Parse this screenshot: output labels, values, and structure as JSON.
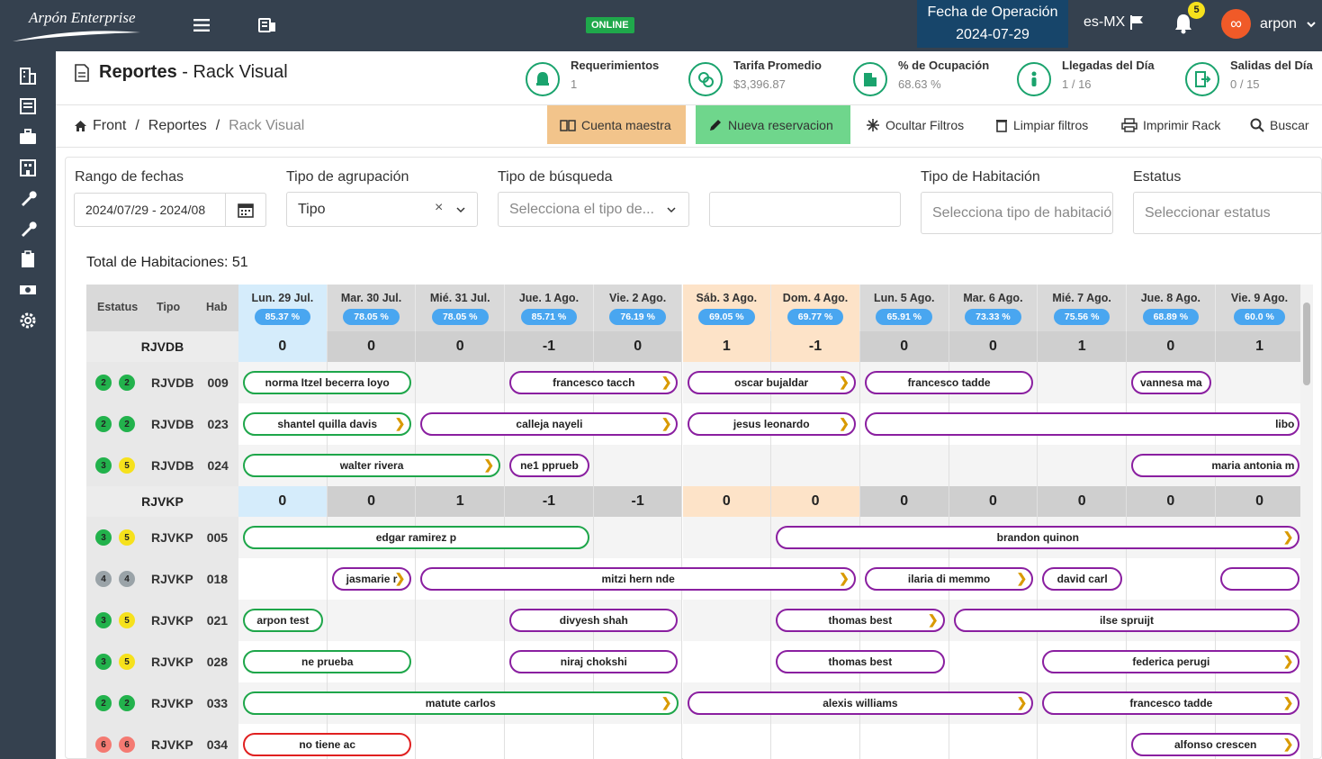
{
  "app": {
    "logo_text": "Arpón Enterprise",
    "online_label": "ONLINE"
  },
  "opdate": {
    "label": "Fecha de Operación",
    "value": "2024-07-29"
  },
  "lang": "es-MX",
  "notifications": {
    "count": "5"
  },
  "user": {
    "name": "arpon"
  },
  "page": {
    "section": "Reportes",
    "title": " - Rack Visual"
  },
  "stats": [
    {
      "label": "Requerimientos",
      "value": "1"
    },
    {
      "label": "Tarifa Promedio",
      "value": "$3,396.87"
    },
    {
      "label": "% de Ocupación",
      "value": "68.63 %"
    },
    {
      "label": "Llegadas del Día",
      "value": "1 / 16"
    },
    {
      "label": "Salidas del Día",
      "value": "0 / 15"
    }
  ],
  "breadcrumb": {
    "home": "Front",
    "sep": "/",
    "reportes": "Reportes",
    "current": "Rack Visual"
  },
  "toolbar": {
    "cuenta": "Cuenta maestra",
    "nueva": "Nueva reservacion",
    "ocultar": "Ocultar Filtros",
    "limpiar": "Limpiar filtros",
    "imprimir": "Imprimir Rack",
    "buscar": "Buscar"
  },
  "filters": {
    "rango_label": "Rango de fechas",
    "rango_value": "2024/07/29 - 2024/08",
    "agrupacion_label": "Tipo de agrupación",
    "agrupacion_value": "Tipo",
    "busqueda_label": "Tipo de búsqueda",
    "busqueda_placeholder": "Selecciona el tipo de...",
    "habitacion_label": "Tipo de Habitación",
    "habitacion_placeholder": "Selecciona tipo de habitació",
    "estatus_label": "Estatus",
    "estatus_placeholder": "Seleccionar estatus"
  },
  "total": "Total de Habitaciones: 51",
  "grid_headers": {
    "estatus": "Estatus",
    "tipo": "Tipo",
    "hab": "Hab"
  },
  "colors": {
    "topbar": "#35414f",
    "accent_green": "#1aa36d",
    "weekend": "#fde3c8",
    "today": "#d5ecfb",
    "res_green": "#1ea64a",
    "res_purple": "#8a1fa0",
    "res_red": "#e02020"
  },
  "days": [
    {
      "label": "Lun. 29 Jul.",
      "pct": "85.37 %",
      "kind": "today"
    },
    {
      "label": "Mar. 30 Jul.",
      "pct": "78.05 %",
      "kind": "normal"
    },
    {
      "label": "Mié. 31 Jul.",
      "pct": "78.05 %",
      "kind": "normal"
    },
    {
      "label": "Jue. 1 Ago.",
      "pct": "85.71 %",
      "kind": "normal"
    },
    {
      "label": "Vie. 2 Ago.",
      "pct": "76.19 %",
      "kind": "normal"
    },
    {
      "label": "Sáb. 3 Ago.",
      "pct": "69.05 %",
      "kind": "weekend"
    },
    {
      "label": "Dom. 4 Ago.",
      "pct": "69.77 %",
      "kind": "weekend"
    },
    {
      "label": "Lun. 5 Ago.",
      "pct": "65.91 %",
      "kind": "normal"
    },
    {
      "label": "Mar. 6 Ago.",
      "pct": "73.33 %",
      "kind": "normal"
    },
    {
      "label": "Mié. 7 Ago.",
      "pct": "75.56 %",
      "kind": "normal"
    },
    {
      "label": "Jue. 8 Ago.",
      "pct": "68.89 %",
      "kind": "normal"
    },
    {
      "label": "Vie. 9 Ago.",
      "pct": "60.0 %",
      "kind": "normal"
    }
  ],
  "groups": [
    {
      "name": "RJVDB",
      "counts": [
        "0",
        "0",
        "0",
        "-1",
        "0",
        "1",
        "-1",
        "0",
        "0",
        "1",
        "0",
        "1"
      ],
      "rooms": [
        {
          "s1": "2",
          "s1c": "green",
          "s2": "2",
          "s2c": "green",
          "tipo": "RJVDB",
          "hab": "009",
          "res": [
            {
              "name": "norma Itzel becerra loyo",
              "start": 0,
              "span": 2,
              "color": "g",
              "arrow": false
            },
            {
              "name": "francesco tacch",
              "start": 3,
              "span": 2,
              "color": "p",
              "arrow": true
            },
            {
              "name": "oscar bujaldar",
              "start": 5,
              "span": 2,
              "color": "p",
              "arrow": true
            },
            {
              "name": "francesco tadde",
              "start": 7,
              "span": 2,
              "color": "p",
              "arrow": false
            },
            {
              "name": "vannesa ma",
              "start": 10,
              "span": 1,
              "color": "p",
              "arrow": false
            }
          ]
        },
        {
          "s1": "2",
          "s1c": "green",
          "s2": "2",
          "s2c": "green",
          "tipo": "RJVDB",
          "hab": "023",
          "res": [
            {
              "name": "shantel quilla davis",
              "start": 0,
              "span": 2,
              "color": "g",
              "arrow": true
            },
            {
              "name": "calleja nayeli",
              "start": 2,
              "span": 3,
              "color": "p",
              "arrow": true
            },
            {
              "name": "jesus leonardo",
              "start": 5,
              "span": 2,
              "color": "p",
              "arrow": true
            },
            {
              "name": "libo",
              "start": 7,
              "span": 5,
              "color": "p",
              "arrow": false,
              "align": "right"
            }
          ]
        },
        {
          "s1": "3",
          "s1c": "green",
          "s2": "5",
          "s2c": "yellow",
          "tipo": "RJVDB",
          "hab": "024",
          "res": [
            {
              "name": "walter rivera",
              "start": 0,
              "span": 3,
              "color": "g",
              "arrow": true
            },
            {
              "name": "ne1 pprueb",
              "start": 3,
              "span": 1,
              "color": "p",
              "arrow": false
            },
            {
              "name": "maria antonia m",
              "start": 10,
              "span": 2,
              "color": "p",
              "arrow": false,
              "align": "right"
            }
          ]
        }
      ]
    },
    {
      "name": "RJVKP",
      "counts": [
        "0",
        "0",
        "1",
        "-1",
        "-1",
        "0",
        "0",
        "0",
        "0",
        "0",
        "0",
        "0"
      ],
      "rooms": [
        {
          "s1": "3",
          "s1c": "green",
          "s2": "5",
          "s2c": "yellow",
          "tipo": "RJVKP",
          "hab": "005",
          "res": [
            {
              "name": "edgar ramirez p",
              "start": 0,
              "span": 4,
              "color": "g",
              "arrow": false
            },
            {
              "name": "brandon quinon",
              "start": 6,
              "span": 6,
              "color": "p",
              "arrow": true
            }
          ]
        },
        {
          "s1": "4",
          "s1c": "gray",
          "s2": "4",
          "s2c": "gray",
          "tipo": "RJVKP",
          "hab": "018",
          "res": [
            {
              "name": "jasmarie r",
              "start": 1,
              "span": 1,
              "color": "p",
              "arrow": true
            },
            {
              "name": "mitzi hern nde",
              "start": 2,
              "span": 5,
              "color": "p",
              "arrow": true
            },
            {
              "name": "ilaria di memmo",
              "start": 7,
              "span": 2,
              "color": "p",
              "arrow": true
            },
            {
              "name": "david carl",
              "start": 9,
              "span": 1,
              "color": "p",
              "arrow": false
            },
            {
              "name": "",
              "start": 11,
              "span": 1,
              "color": "p",
              "arrow": false
            }
          ]
        },
        {
          "s1": "3",
          "s1c": "green",
          "s2": "5",
          "s2c": "yellow",
          "tipo": "RJVKP",
          "hab": "021",
          "res": [
            {
              "name": "arpon test",
              "start": 0,
              "span": 1,
              "color": "g",
              "arrow": false
            },
            {
              "name": "divyesh shah",
              "start": 3,
              "span": 2,
              "color": "p",
              "arrow": false
            },
            {
              "name": "thomas best",
              "start": 6,
              "span": 2,
              "color": "p",
              "arrow": true
            },
            {
              "name": "ilse spruijt",
              "start": 8,
              "span": 4,
              "color": "p",
              "arrow": false
            }
          ]
        },
        {
          "s1": "3",
          "s1c": "green",
          "s2": "5",
          "s2c": "yellow",
          "tipo": "RJVKP",
          "hab": "028",
          "res": [
            {
              "name": "ne prueba",
              "start": 0,
              "span": 2,
              "color": "g",
              "arrow": false
            },
            {
              "name": "niraj chokshi",
              "start": 3,
              "span": 2,
              "color": "p",
              "arrow": false
            },
            {
              "name": "thomas best",
              "start": 6,
              "span": 2,
              "color": "p",
              "arrow": false
            },
            {
              "name": "federica perugi",
              "start": 9,
              "span": 3,
              "color": "p",
              "arrow": true
            }
          ]
        },
        {
          "s1": "2",
          "s1c": "green",
          "s2": "2",
          "s2c": "green",
          "tipo": "RJVKP",
          "hab": "033",
          "res": [
            {
              "name": "matute carlos",
              "start": 0,
              "span": 5,
              "color": "g",
              "arrow": true
            },
            {
              "name": "alexis williams",
              "start": 5,
              "span": 4,
              "color": "p",
              "arrow": true
            },
            {
              "name": "francesco tadde",
              "start": 9,
              "span": 3,
              "color": "p",
              "arrow": true
            }
          ]
        },
        {
          "s1": "6",
          "s1c": "red",
          "s2": "6",
          "s2c": "red",
          "tipo": "RJVKP",
          "hab": "034",
          "res": [
            {
              "name": "no tiene ac",
              "start": 0,
              "span": 2,
              "color": "r",
              "arrow": false
            },
            {
              "name": "alfonso crescen",
              "start": 10,
              "span": 2,
              "color": "p",
              "arrow": true
            }
          ]
        }
      ]
    }
  ]
}
